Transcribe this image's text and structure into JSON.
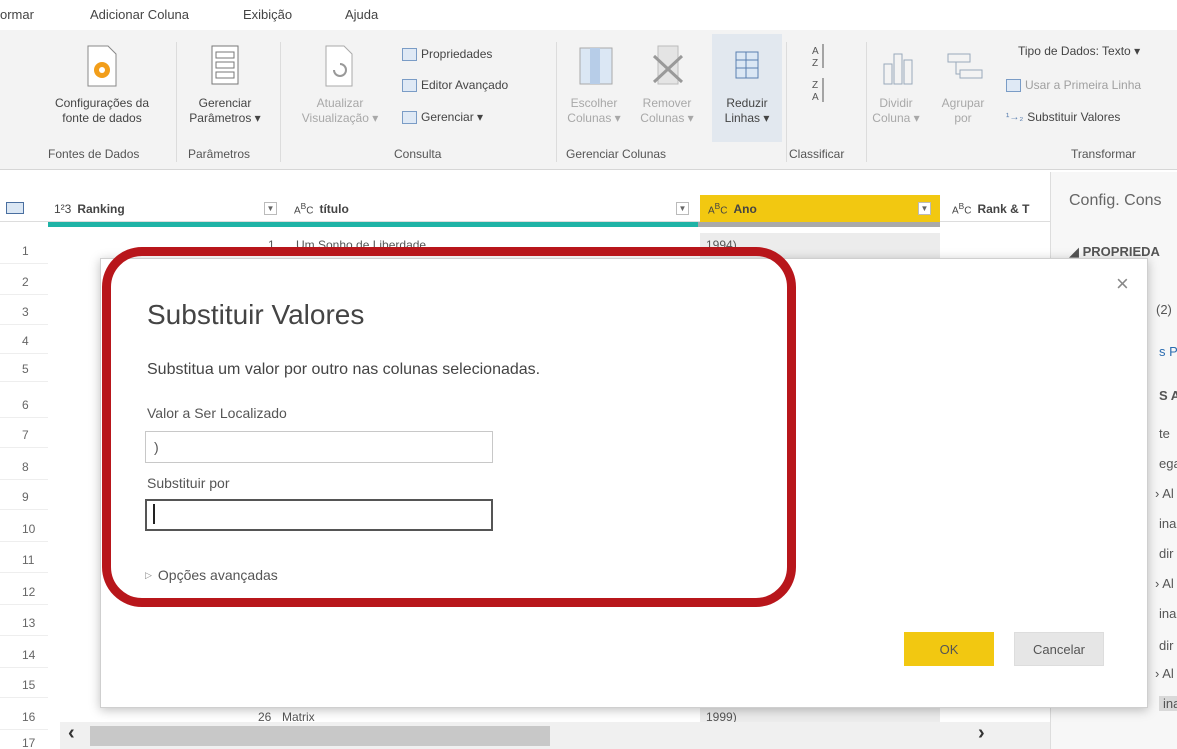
{
  "menu": {
    "items": [
      "ormar",
      "Adicionar Coluna",
      "Exibição",
      "Ajuda"
    ]
  },
  "ribbon": {
    "data_source_settings": [
      "Configurações da",
      "fonte de dados"
    ],
    "manage_parameters": [
      "Gerenciar",
      "Parâmetros ▾"
    ],
    "refresh_preview": [
      "Atualizar",
      "Visualização ▾"
    ],
    "properties": "Propriedades",
    "advanced_editor": "Editor Avançado",
    "manage": "Gerenciar ▾",
    "choose_columns": [
      "Escolher",
      "Colunas ▾"
    ],
    "remove_columns": [
      "Remover",
      "Colunas ▾"
    ],
    "reduce_rows": [
      "Reduzir",
      "Linhas ▾"
    ],
    "split_column": [
      "Dividir",
      "Coluna ▾"
    ],
    "group_by": [
      "Agrupar",
      "por"
    ],
    "data_type": "Tipo de Dados: Texto ▾",
    "use_first_row": "Usar a Primeira Linha",
    "replace_values": "Substituir Valores",
    "groups": {
      "data_sources": "Fontes de Dados",
      "parameters": "Parâmetros",
      "query": "Consulta",
      "manage_columns": "Gerenciar Colunas",
      "sort": "Classificar",
      "transform": "Transformar"
    }
  },
  "grid": {
    "columns": [
      {
        "type": "1²3",
        "name": "Ranking"
      },
      {
        "type": "A^B_C",
        "name": "título"
      },
      {
        "type": "A^B_C",
        "name": "Ano"
      },
      {
        "type": "A^B_C",
        "name": "Rank & T"
      }
    ],
    "row_numbers": [
      "1",
      "2",
      "3",
      "4",
      "5",
      "6",
      "7",
      "8",
      "9",
      "10",
      "11",
      "12",
      "13",
      "14",
      "15",
      "16",
      "17"
    ],
    "row1": {
      "rank": "1",
      "title": "Um Sonho de Liberdade",
      "year": "1994)"
    },
    "row16": {
      "rank": "26",
      "title": "Matrix",
      "year": "1999)"
    }
  },
  "panel": {
    "title": "Config. Cons",
    "properties": "◢ PROPRIEDA",
    "fragments": [
      "(2)",
      "s Pr",
      "S AP",
      "te",
      "ega",
      "› Al",
      "ina",
      "dir",
      "› Al",
      "ina",
      "dir",
      "› Al",
      "ina"
    ]
  },
  "dialog": {
    "title": "Substituir Valores",
    "description": "Substitua um valor por outro nas colunas selecionadas.",
    "find_label": "Valor a Ser Localizado",
    "find_value": ")",
    "replace_label": "Substituir por",
    "replace_value": "",
    "advanced_options": "Opções avançadas",
    "ok": "OK",
    "cancel": "Cancelar",
    "close": "×"
  },
  "colors": {
    "accent_yellow": "#f2c811",
    "highlight_red": "#b8161b",
    "teal": "#1fb3a6"
  }
}
